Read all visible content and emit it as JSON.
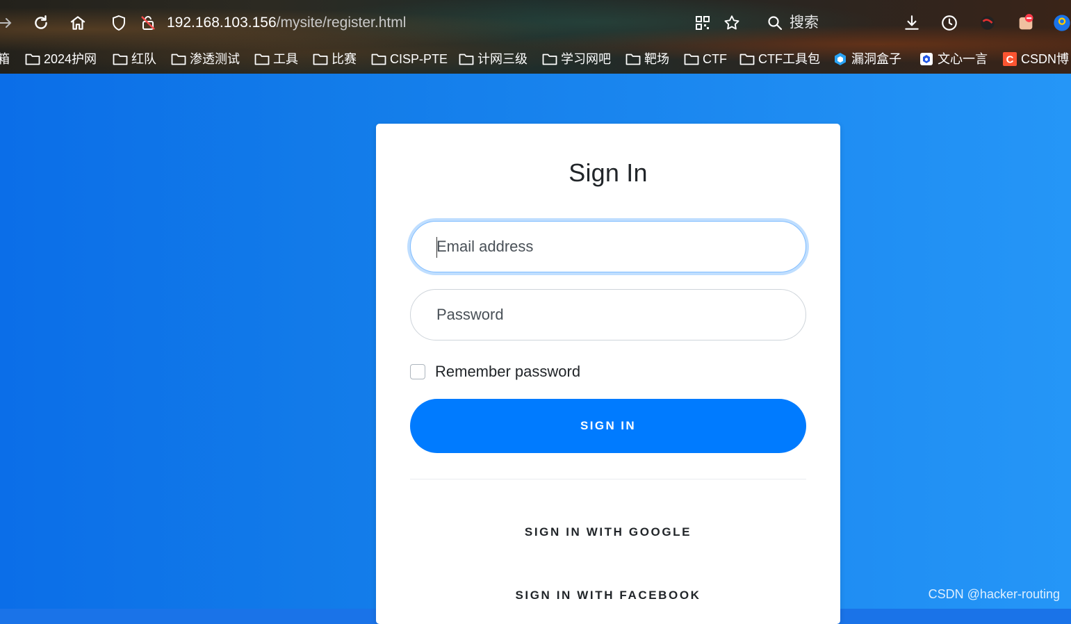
{
  "browser": {
    "url_host": "192.168.103.156",
    "url_path": "/mysite/register.html",
    "search_label": "搜索",
    "bookmarks": [
      {
        "label": "箱",
        "icon": "none"
      },
      {
        "label": "2024护网",
        "icon": "folder-icon"
      },
      {
        "label": "红队",
        "icon": "folder-icon"
      },
      {
        "label": "渗透测试",
        "icon": "folder-icon"
      },
      {
        "label": "工具",
        "icon": "folder-icon"
      },
      {
        "label": "比赛",
        "icon": "folder-icon"
      },
      {
        "label": "CISP-PTE",
        "icon": "folder-icon"
      },
      {
        "label": "计网三级",
        "icon": "folder-icon"
      },
      {
        "label": "学习网吧",
        "icon": "folder-icon"
      },
      {
        "label": "靶场",
        "icon": "folder-icon"
      },
      {
        "label": "CTF",
        "icon": "folder-icon"
      },
      {
        "label": "CTF工具包",
        "icon": "folder-icon"
      },
      {
        "label": "漏洞盒子",
        "icon": "hexagon-site-icon"
      },
      {
        "label": "文心一言",
        "icon": "cube-site-icon"
      },
      {
        "label": "CSDN博",
        "icon": "csdn-icon"
      }
    ]
  },
  "login": {
    "title": "Sign In",
    "email_placeholder": "Email address",
    "password_placeholder": "Password",
    "remember_label": "Remember password",
    "remember_checked": false,
    "sign_in_label": "SIGN IN",
    "google_label": "SIGN IN WITH GOOGLE",
    "facebook_label": "SIGN IN WITH FACEBOOK"
  },
  "watermark": "CSDN @hacker-routing",
  "colors": {
    "primary": "#007bff",
    "background_left": "#0b6ee8",
    "background_right": "#2596f7",
    "csdn": "#fc5531"
  }
}
